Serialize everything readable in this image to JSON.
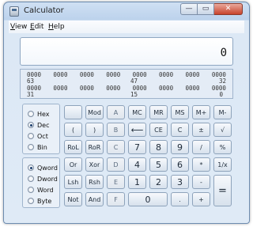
{
  "window": {
    "title": "Calculator",
    "controls": {
      "minimize": "—",
      "maximize": "▭",
      "close": "✕"
    }
  },
  "menu": [
    {
      "label": "View",
      "accel": "V",
      "rest": "iew"
    },
    {
      "label": "Edit",
      "accel": "E",
      "rest": "dit"
    },
    {
      "label": "Help",
      "accel": "H",
      "rest": "elp"
    }
  ],
  "display": {
    "value": "0"
  },
  "bits": {
    "row1": [
      "0000",
      "0000",
      "0000",
      "0000",
      "0000",
      "0000",
      "0000",
      "0000"
    ],
    "row1_positions": [
      "63",
      "47",
      "32"
    ],
    "row2": [
      "0000",
      "0000",
      "0000",
      "0000",
      "0000",
      "0000",
      "0000",
      "0000"
    ],
    "row2_positions": [
      "31",
      "15",
      "0"
    ]
  },
  "radix": {
    "options": [
      "Hex",
      "Dec",
      "Oct",
      "Bin"
    ],
    "selected": "Dec"
  },
  "word_size": {
    "options": [
      "Qword",
      "Dword",
      "Word",
      "Byte"
    ],
    "selected": "Qword"
  },
  "keys": {
    "blank": "",
    "mod": "Mod",
    "a": "A",
    "mc": "MC",
    "mr": "MR",
    "ms": "MS",
    "mplus": "M+",
    "mminus": "M-",
    "lparen": "(",
    "rparen": ")",
    "b": "B",
    "backspace": "⟵",
    "ce": "CE",
    "c": "C",
    "plusminus": "±",
    "sqrt": "√",
    "rol": "RoL",
    "ror": "RoR",
    "c_hex": "C",
    "seven": "7",
    "eight": "8",
    "nine": "9",
    "divide": "/",
    "percent": "%",
    "or": "Or",
    "xor": "Xor",
    "d": "D",
    "four": "4",
    "five": "5",
    "six": "6",
    "multiply": "*",
    "reciprocal": "1/x",
    "lsh": "Lsh",
    "rsh": "Rsh",
    "e": "E",
    "one": "1",
    "two": "2",
    "three": "3",
    "minus": "-",
    "equals": "=",
    "not": "Not",
    "and": "And",
    "f": "F",
    "zero": "0",
    "decimal": ".",
    "plus": "+"
  }
}
